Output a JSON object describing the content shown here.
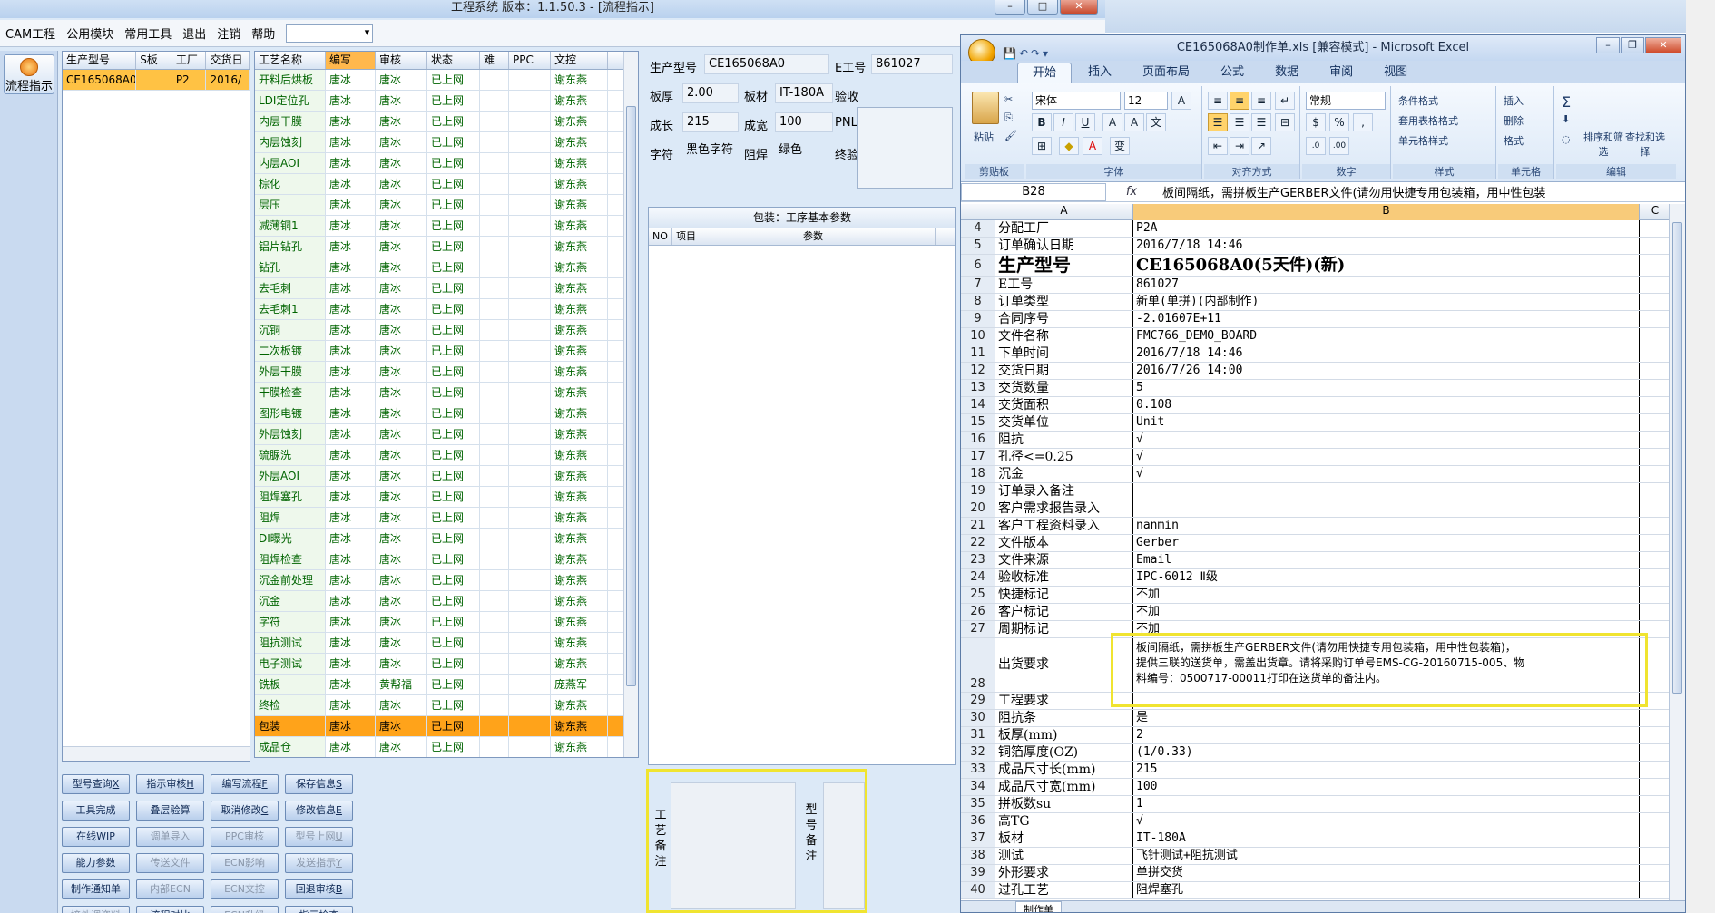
{
  "app": {
    "title": "工程系统  版本：1.1.50.3 - [流程指示]",
    "menu": [
      "CAM工程",
      "公用模块",
      "常用工具",
      "退出",
      "注销",
      "帮助"
    ],
    "nav_button": "流程指示"
  },
  "model_grid": {
    "columns": [
      "生产型号",
      "S板",
      "工厂",
      "交货日"
    ],
    "rows": [
      [
        "CE165068A0",
        "",
        "P2",
        "2016/"
      ]
    ]
  },
  "process_grid": {
    "columns": [
      "工艺名称",
      "编写",
      "审核",
      "状态",
      "难",
      "PPC",
      "文控"
    ],
    "rows": [
      [
        "开料后烘板",
        "唐冰",
        "唐冰",
        "已上网",
        "",
        "",
        "谢东燕"
      ],
      [
        "LDI定位孔",
        "唐冰",
        "唐冰",
        "已上网",
        "",
        "",
        "谢东燕"
      ],
      [
        "内层干膜",
        "唐冰",
        "唐冰",
        "已上网",
        "",
        "",
        "谢东燕"
      ],
      [
        "内层蚀刻",
        "唐冰",
        "唐冰",
        "已上网",
        "",
        "",
        "谢东燕"
      ],
      [
        "内层AOI",
        "唐冰",
        "唐冰",
        "已上网",
        "",
        "",
        "谢东燕"
      ],
      [
        "棕化",
        "唐冰",
        "唐冰",
        "已上网",
        "",
        "",
        "谢东燕"
      ],
      [
        "层压",
        "唐冰",
        "唐冰",
        "已上网",
        "",
        "",
        "谢东燕"
      ],
      [
        "减薄铜1",
        "唐冰",
        "唐冰",
        "已上网",
        "",
        "",
        "谢东燕"
      ],
      [
        "铝片钻孔",
        "唐冰",
        "唐冰",
        "已上网",
        "",
        "",
        "谢东燕"
      ],
      [
        "钻孔",
        "唐冰",
        "唐冰",
        "已上网",
        "",
        "",
        "谢东燕"
      ],
      [
        "去毛刺",
        "唐冰",
        "唐冰",
        "已上网",
        "",
        "",
        "谢东燕"
      ],
      [
        "去毛刺1",
        "唐冰",
        "唐冰",
        "已上网",
        "",
        "",
        "谢东燕"
      ],
      [
        "沉铜",
        "唐冰",
        "唐冰",
        "已上网",
        "",
        "",
        "谢东燕"
      ],
      [
        "二次板镀",
        "唐冰",
        "唐冰",
        "已上网",
        "",
        "",
        "谢东燕"
      ],
      [
        "外层干膜",
        "唐冰",
        "唐冰",
        "已上网",
        "",
        "",
        "谢东燕"
      ],
      [
        "干膜检查",
        "唐冰",
        "唐冰",
        "已上网",
        "",
        "",
        "谢东燕"
      ],
      [
        "图形电镀",
        "唐冰",
        "唐冰",
        "已上网",
        "",
        "",
        "谢东燕"
      ],
      [
        "外层蚀刻",
        "唐冰",
        "唐冰",
        "已上网",
        "",
        "",
        "谢东燕"
      ],
      [
        "硫脲洗",
        "唐冰",
        "唐冰",
        "已上网",
        "",
        "",
        "谢东燕"
      ],
      [
        "外层AOI",
        "唐冰",
        "唐冰",
        "已上网",
        "",
        "",
        "谢东燕"
      ],
      [
        "阻焊塞孔",
        "唐冰",
        "唐冰",
        "已上网",
        "",
        "",
        "谢东燕"
      ],
      [
        "阻焊",
        "唐冰",
        "唐冰",
        "已上网",
        "",
        "",
        "谢东燕"
      ],
      [
        "DI曝光",
        "唐冰",
        "唐冰",
        "已上网",
        "",
        "",
        "谢东燕"
      ],
      [
        "阻焊检查",
        "唐冰",
        "唐冰",
        "已上网",
        "",
        "",
        "谢东燕"
      ],
      [
        "沉金前处理",
        "唐冰",
        "唐冰",
        "已上网",
        "",
        "",
        "谢东燕"
      ],
      [
        "沉金",
        "唐冰",
        "唐冰",
        "已上网",
        "",
        "",
        "谢东燕"
      ],
      [
        "字符",
        "唐冰",
        "唐冰",
        "已上网",
        "",
        "",
        "谢东燕"
      ],
      [
        "阻抗测试",
        "唐冰",
        "唐冰",
        "已上网",
        "",
        "",
        "谢东燕"
      ],
      [
        "电子测试",
        "唐冰",
        "唐冰",
        "已上网",
        "",
        "",
        "谢东燕"
      ],
      [
        "铣板",
        "唐冰",
        "黄帮福",
        "已上网",
        "",
        "",
        "庞燕军"
      ],
      [
        "终检",
        "唐冰",
        "唐冰",
        "已上网",
        "",
        "",
        "谢东燕"
      ],
      [
        "包装",
        "唐冰",
        "唐冰",
        "已上网",
        "",
        "",
        "谢东燕"
      ],
      [
        "成品仓",
        "唐冰",
        "唐冰",
        "已上网",
        "",
        "",
        "谢东燕"
      ]
    ],
    "selected_index": 31
  },
  "params": {
    "model_label": "生产型号",
    "model_value": "CE165068A0",
    "eno_label": "E工号",
    "eno_value": "861027",
    "thick_label": "板厚",
    "thick_value": "2.00",
    "material_label": "板材",
    "material_value": "IT-180A",
    "accept_label": "验收",
    "len_label": "成长",
    "len_value": "215",
    "width_label": "成宽",
    "width_value": "100",
    "pnl_label": "PNL",
    "char_label": "字符",
    "char_value": "黑色字符",
    "mask_label": "阻焊",
    "mask_value": "绿色",
    "final_label": "终验"
  },
  "proc_params": {
    "title": "包装：工序基本参数",
    "columns": [
      "NO",
      "项目",
      "参数"
    ]
  },
  "buttons": [
    {
      "label": "型号查询",
      "key": "X",
      "enabled": true
    },
    {
      "label": "指示审核",
      "key": "H",
      "enabled": true
    },
    {
      "label": "编写流程",
      "key": "F",
      "enabled": true
    },
    {
      "label": "保存信息",
      "key": "S",
      "enabled": true
    },
    {
      "label": "工具完成",
      "key": "",
      "enabled": true
    },
    {
      "label": "叠层验算",
      "key": "",
      "enabled": true
    },
    {
      "label": "取消修改",
      "key": "C",
      "enabled": true
    },
    {
      "label": "修改信息",
      "key": "E",
      "enabled": true
    },
    {
      "label": "在线WIP",
      "key": "",
      "enabled": true
    },
    {
      "label": "调单导入",
      "key": "",
      "enabled": false
    },
    {
      "label": "PPC审核",
      "key": "",
      "enabled": false
    },
    {
      "label": "型号上网",
      "key": "U",
      "enabled": false
    },
    {
      "label": "能力参数",
      "key": "",
      "enabled": true
    },
    {
      "label": "传送文件",
      "key": "",
      "enabled": false
    },
    {
      "label": "ECN影响",
      "key": "",
      "enabled": false
    },
    {
      "label": "发送指示",
      "key": "Y",
      "enabled": false
    },
    {
      "label": "制作通知单",
      "key": "",
      "enabled": true
    },
    {
      "label": "内部ECN",
      "key": "",
      "enabled": false
    },
    {
      "label": "ECN文控",
      "key": "",
      "enabled": false
    },
    {
      "label": "回退审核",
      "key": "B",
      "enabled": true
    },
    {
      "label": "接外调资料",
      "key": "",
      "enabled": false
    },
    {
      "label": "流程对比",
      "key": "",
      "enabled": true
    },
    {
      "label": "ECN升级",
      "key": "",
      "enabled": false
    },
    {
      "label": "指示检查",
      "key": "",
      "enabled": true
    }
  ],
  "remarks": {
    "process_label": "工艺备注",
    "model_label": "型号备注"
  },
  "excel": {
    "title": "CE165068A0制作单.xls [兼容模式] - Microsoft Excel",
    "tabs": [
      "开始",
      "插入",
      "页面布局",
      "公式",
      "数据",
      "审阅",
      "视图"
    ],
    "active_tab": "开始",
    "ribbon": {
      "clipboard": "剪贴板",
      "paste": "粘贴",
      "font_group": "字体",
      "font_name": "宋体",
      "font_size": "12",
      "align_group": "对齐方式",
      "number_group": "数字",
      "number_format": "常规",
      "style_group": "样式",
      "cond_format": "条件格式",
      "table_format": "套用表格格式",
      "cell_style": "单元格样式",
      "cells_group": "单元格",
      "insert": "插入",
      "delete": "删除",
      "format": "格式",
      "edit_group": "编辑",
      "sort_filter": "排序和筛选",
      "find_select": "查找和选择"
    },
    "name_box": "B28",
    "formula": "板间隔纸，需拼板生产GERBER文件(请勿用快捷专用包装箱，用中性包装",
    "col_headers": [
      "A",
      "B",
      "C"
    ],
    "rows": [
      {
        "n": "4",
        "a": "分配工厂",
        "b": "P2A"
      },
      {
        "n": "5",
        "a": "订单确认日期",
        "b": "2016/7/18 14:46"
      },
      {
        "n": "6",
        "a": "生产型号",
        "b": "CE165068A0(5天件)(新)",
        "big": true
      },
      {
        "n": "7",
        "a": "E工号",
        "b": "861027"
      },
      {
        "n": "8",
        "a": "订单类型",
        "b": "新单(单拼)(内部制作)"
      },
      {
        "n": "9",
        "a": "合同序号",
        "b": "-2.01607E+11"
      },
      {
        "n": "10",
        "a": "文件名称",
        "b": "FMC766_DEMO_BOARD"
      },
      {
        "n": "11",
        "a": "下单时间",
        "b": "2016/7/18 14:46"
      },
      {
        "n": "12",
        "a": "交货日期",
        "b": "2016/7/26 14:00"
      },
      {
        "n": "13",
        "a": "交货数量",
        "b": "5"
      },
      {
        "n": "14",
        "a": "交货面积",
        "b": "0.108"
      },
      {
        "n": "15",
        "a": "交货单位",
        "b": "Unit"
      },
      {
        "n": "16",
        "a": "阻抗",
        "b": "√"
      },
      {
        "n": "17",
        "a": "孔径<=0.25",
        "b": "√"
      },
      {
        "n": "18",
        "a": "沉金",
        "b": "√"
      },
      {
        "n": "19",
        "a": "订单录入备注",
        "b": ""
      },
      {
        "n": "20",
        "a": "客户需求报告录入",
        "b": ""
      },
      {
        "n": "21",
        "a": "客户工程资料录入",
        "b": "nanmin"
      },
      {
        "n": "22",
        "a": "文件版本",
        "b": "Gerber"
      },
      {
        "n": "23",
        "a": "文件来源",
        "b": "Email"
      },
      {
        "n": "24",
        "a": "验收标准",
        "b": "IPC-6012 Ⅱ级"
      },
      {
        "n": "25",
        "a": "快捷标记",
        "b": "不加"
      },
      {
        "n": "26",
        "a": "客户标记",
        "b": "不加"
      },
      {
        "n": "27",
        "a": "周期标记",
        "b": "不加"
      },
      {
        "n": "28",
        "a": "出货要求",
        "b": "板间隔纸，需拼板生产GERBER文件(请勿用快捷专用包装箱，用中性包装箱)，|提供三联的送货单，需盖出货章。请将采购订单号EMS-CG-20160715-005、物|料编号：0500717-00011打印在送货单的备注内。",
        "tall": true
      },
      {
        "n": "29",
        "a": "工程要求",
        "b": ""
      },
      {
        "n": "30",
        "a": "阻抗条",
        "b": "是"
      },
      {
        "n": "31",
        "a": "板厚(mm)",
        "b": "2"
      },
      {
        "n": "32",
        "a": "铜箔厚度(OZ)",
        "b": " (1/0.33)"
      },
      {
        "n": "33",
        "a": "成品尺寸长(mm)",
        "b": "215"
      },
      {
        "n": "34",
        "a": "成品尺寸宽(mm)",
        "b": "100"
      },
      {
        "n": "35",
        "a": "拼板数su",
        "b": "1"
      },
      {
        "n": "36",
        "a": "高TG",
        "b": "√"
      },
      {
        "n": "37",
        "a": "板材",
        "b": "IT-180A"
      },
      {
        "n": "38",
        "a": "测试",
        "b": "飞针测试+阻抗测试"
      },
      {
        "n": "39",
        "a": "外形要求",
        "b": "单拼交货"
      },
      {
        "n": "40",
        "a": "过孔工艺",
        "b": "阻焊塞孔"
      }
    ],
    "sheet_tab": "制作单"
  },
  "colors": {
    "selected_row": "#ffa31a",
    "highlight": "#f0e430",
    "status_text": "#006400"
  }
}
